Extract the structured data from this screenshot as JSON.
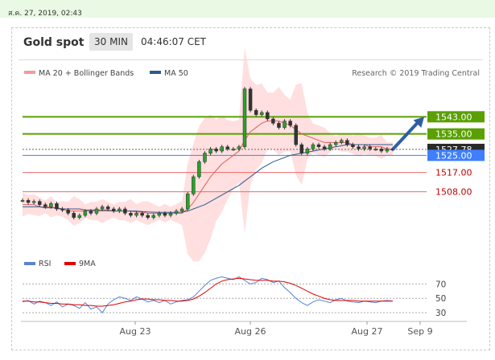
{
  "datetime": "ส.ค. 27, 2019, 02:43",
  "header": {
    "symbol": "Gold spot",
    "timeframe": "30 MIN",
    "time": "04:46:07 CET"
  },
  "legend": {
    "ma20_bb": "MA 20 + Bollinger Bands",
    "ma50": "MA 50",
    "credit": "Research © 2019 Trading Central"
  },
  "rsi_legend": {
    "rsi": "RSI",
    "ma9": "9MA"
  },
  "colors": {
    "accent_green": "#5aa000",
    "support_red": "#c00000",
    "blue_line": "#3f7fff",
    "arrow": "#2e5fa5",
    "band_fill": "#ffd4d4",
    "ma20": "#e06060",
    "ma50": "#2c5b8c",
    "candle": "#333333",
    "rsi": "#5a83d0",
    "rsi_ma": "#e00000"
  },
  "chart_data": [
    {
      "type": "candlestick",
      "title": "Gold spot",
      "x_ticks": [
        "Aug 23",
        "Aug 26",
        "Aug 27",
        "Sep 9"
      ],
      "ylim": [
        1485,
        1560
      ],
      "series": [
        {
          "name": "MA 20 + Bollinger Bands"
        },
        {
          "name": "MA 50"
        }
      ],
      "levels": [
        {
          "label": "1543.00",
          "value": 1543,
          "style": "resistance"
        },
        {
          "label": "1535.00",
          "value": 1535,
          "style": "resistance"
        },
        {
          "label": "1527.78",
          "value": 1527.78,
          "style": "last_price"
        },
        {
          "label": "1525.00",
          "value": 1525,
          "style": "pivot"
        },
        {
          "label": "1517.00",
          "value": 1517,
          "style": "support"
        },
        {
          "label": "1508.00",
          "value": 1508,
          "style": "support"
        }
      ],
      "close_path": [
        1504,
        1503,
        1503.5,
        1502,
        1501,
        1502.5,
        1500,
        1499.5,
        1498,
        1496,
        1497,
        1499,
        1498,
        1500,
        1501,
        1500,
        1499,
        1500,
        1498,
        1497,
        1498,
        1497,
        1496,
        1497,
        1498,
        1497,
        1498,
        1499,
        1500,
        1507,
        1515,
        1522,
        1526,
        1528,
        1527,
        1529,
        1528,
        1528,
        1529,
        1556,
        1546,
        1544,
        1545,
        1542,
        1540,
        1538,
        1541,
        1539,
        1530,
        1526,
        1528,
        1530,
        1529,
        1528,
        1530,
        1531,
        1532,
        1530,
        1529,
        1528,
        1529,
        1528,
        1528,
        1527,
        1528,
        1527.78
      ],
      "ma20": [
        1502,
        1502,
        1502,
        1501,
        1501,
        1501,
        1500,
        1500,
        1499,
        1499,
        1499,
        1499,
        1499,
        1499,
        1499,
        1499,
        1499,
        1499,
        1499,
        1499,
        1498.5,
        1498.5,
        1498,
        1498,
        1498,
        1498,
        1498,
        1498,
        1498,
        1500,
        1503,
        1507,
        1511,
        1515,
        1518,
        1521,
        1523,
        1525,
        1527,
        1532,
        1536,
        1538,
        1540,
        1541,
        1541,
        1541,
        1540,
        1539,
        1537,
        1535,
        1534,
        1533,
        1532,
        1531,
        1531,
        1531,
        1531,
        1531,
        1530,
        1530,
        1530,
        1529,
        1529,
        1529,
        1528,
        1528
      ],
      "ma50": [
        1501,
        1501,
        1501,
        1501,
        1500.5,
        1500.5,
        1500.5,
        1500,
        1500,
        1500,
        1500,
        1499.5,
        1499.5,
        1499.5,
        1499.5,
        1499.5,
        1499,
        1499,
        1499,
        1499,
        1499,
        1498.8,
        1498.6,
        1498.5,
        1498.4,
        1498.4,
        1498.4,
        1498.4,
        1498.5,
        1499,
        1500,
        1501,
        1502,
        1503.5,
        1505,
        1506.5,
        1508,
        1509.5,
        1511,
        1513,
        1515,
        1517,
        1519,
        1520.5,
        1522,
        1523,
        1524,
        1525,
        1525.5,
        1526,
        1526.5,
        1527,
        1527.5,
        1528,
        1528.5,
        1529,
        1529.5,
        1530,
        1530,
        1530,
        1530,
        1530,
        1530,
        1530,
        1530,
        1530
      ],
      "projection": {
        "from": 1527.78,
        "to": 1543
      }
    },
    {
      "type": "line",
      "title": "RSI",
      "ylim": [
        20,
        85
      ],
      "y_ticks": [
        70,
        50,
        30
      ],
      "series": [
        {
          "name": "RSI",
          "values": [
            45,
            47,
            42,
            46,
            44,
            40,
            45,
            38,
            42,
            40,
            36,
            44,
            35,
            38,
            30,
            42,
            48,
            52,
            50,
            47,
            52,
            49,
            45,
            47,
            44,
            47,
            42,
            45,
            47,
            48,
            52,
            60,
            68,
            75,
            78,
            80,
            78,
            76,
            80,
            75,
            70,
            72,
            78,
            76,
            72,
            74,
            65,
            58,
            50,
            44,
            40,
            45,
            48,
            46,
            44,
            48,
            50,
            46,
            45,
            44,
            46,
            45,
            44,
            46,
            47,
            46
          ]
        },
        {
          "name": "9MA",
          "values": [
            46,
            46,
            45,
            45,
            44,
            43,
            43,
            42,
            42,
            41,
            41,
            40,
            40,
            39,
            39,
            40,
            41,
            43,
            45,
            46,
            48,
            49,
            49,
            48,
            48,
            47,
            47,
            46,
            46,
            47,
            49,
            53,
            58,
            64,
            70,
            74,
            76,
            77,
            78,
            77,
            76,
            75,
            75,
            75,
            74,
            74,
            73,
            71,
            68,
            64,
            60,
            56,
            53,
            50,
            48,
            47,
            47,
            47,
            47,
            46,
            46,
            46,
            46,
            46,
            46,
            46
          ]
        }
      ]
    }
  ]
}
